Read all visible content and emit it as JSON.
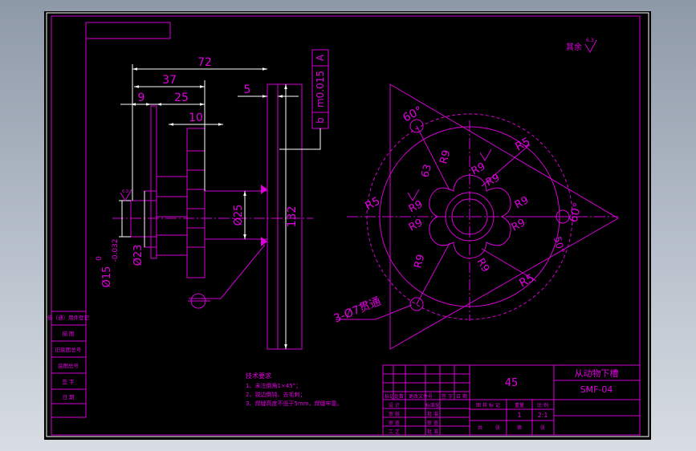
{
  "colors": {
    "line": "#d400d4",
    "outline": "#ffffff",
    "background": "#000000"
  },
  "roughness_note": "其余",
  "roughness_sym": "6.3",
  "dims": {
    "d72": "72",
    "d37": "37",
    "d9": "9",
    "d25": "25",
    "d10": "10",
    "d5": "5",
    "d132": "132",
    "dia25": "Ø25",
    "dia23": "Ø23",
    "dia15": "Ø15",
    "tol_up": "0",
    "tol_low": "-0.032",
    "flatness_val": "m0.015",
    "flatness_sym": "b",
    "datum": "A"
  },
  "front": {
    "r5a": "R5",
    "r5b": "R5",
    "r5c": "R5",
    "r9": [
      "R9",
      "R9",
      "R9",
      "R9",
      "R9",
      "R9",
      "R9",
      "R9",
      "R9"
    ],
    "ang60a": "60°",
    "ang60b": "60°",
    "ang50": "50°",
    "r63": "63",
    "holes": "3-Ø7贯通"
  },
  "tech": {
    "title": "技术要求",
    "l1": "1、未注倒角1×45°；",
    "l2": "2、锐边倒钝、去毛刺；",
    "l3": "3、焊缝高度不低于5mm，焊缝牢靠。"
  },
  "title_block": {
    "material": "45",
    "part_name": "从动物下槽",
    "drawing_no": "SMF-04",
    "scale": "2:1",
    "qty": "1",
    "hdr_left": [
      "标记处数",
      "更改文件号",
      "签 字",
      "日 期"
    ],
    "roles": [
      "设 计",
      "审 核",
      "审 查",
      "工 艺"
    ],
    "roles2": [
      "标准化",
      "批 准",
      "审 查",
      "批 准"
    ],
    "stage": "图 样 标 记",
    "weight": "重量",
    "scale_lbl": "比 例",
    "sheets": [
      "共",
      "张",
      "第",
      "张"
    ]
  },
  "side_block": [
    "借（通）用件登记",
    "描 图",
    "旧底图总号",
    "底图总号",
    "签 字",
    "日 期"
  ]
}
